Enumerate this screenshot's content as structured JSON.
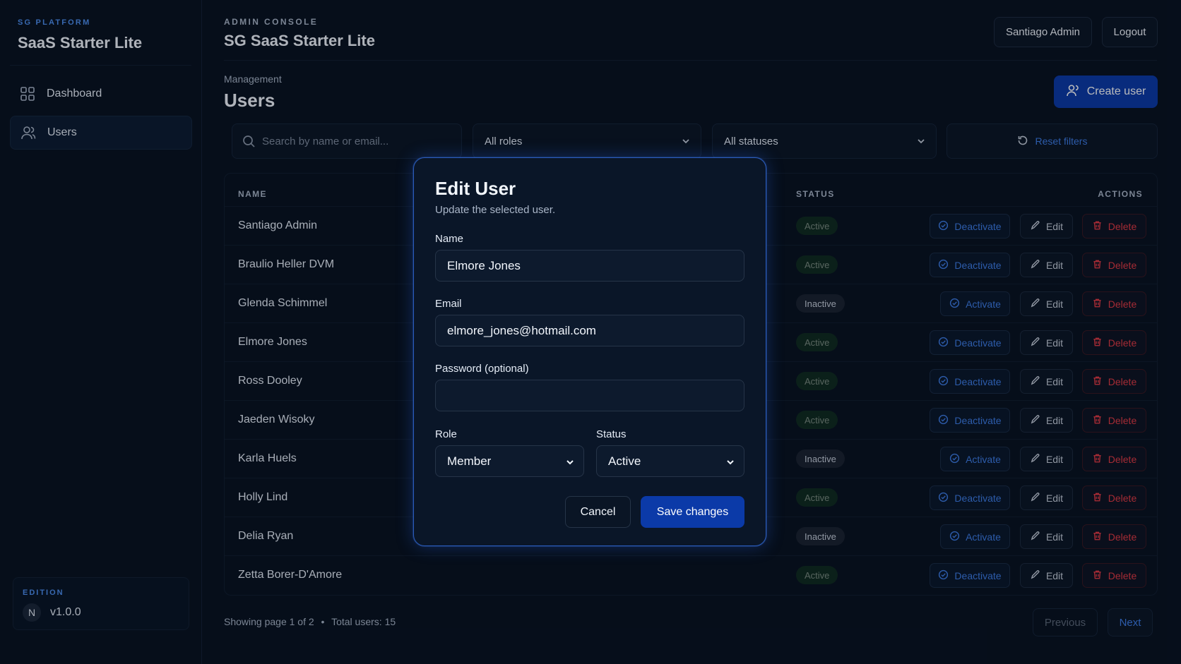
{
  "sidebar": {
    "eyebrow": "SG PLATFORM",
    "title": "SaaS Starter Lite",
    "items": [
      {
        "label": "Dashboard",
        "icon": "grid-icon",
        "active": false
      },
      {
        "label": "Users",
        "icon": "users-icon",
        "active": true
      }
    ],
    "edition": {
      "label": "EDITION",
      "badge": "N",
      "version": "v1.0.0"
    }
  },
  "header": {
    "eyebrow": "ADMIN CONSOLE",
    "title": "SG SaaS Starter Lite",
    "user_button": "Santiago Admin",
    "logout_button": "Logout"
  },
  "page": {
    "breadcrumb": "Management",
    "title": "Users",
    "create_button": "Create user"
  },
  "filters": {
    "search_placeholder": "Search by name or email...",
    "role": "All roles",
    "status": "All statuses",
    "reset": "Reset filters"
  },
  "table": {
    "headers": {
      "name": "NAME",
      "status": "STATUS",
      "actions": "ACTIONS"
    },
    "edit_label": "Edit",
    "delete_label": "Delete",
    "rows": [
      {
        "name": "Santiago Admin",
        "status": "Active",
        "action": "Deactivate"
      },
      {
        "name": "Braulio Heller DVM",
        "status": "Active",
        "action": "Deactivate"
      },
      {
        "name": "Glenda Schimmel",
        "status": "Inactive",
        "action": "Activate"
      },
      {
        "name": "Elmore Jones",
        "status": "Active",
        "action": "Deactivate"
      },
      {
        "name": "Ross Dooley",
        "status": "Active",
        "action": "Deactivate"
      },
      {
        "name": "Jaeden Wisoky",
        "status": "Active",
        "action": "Deactivate"
      },
      {
        "name": "Karla Huels",
        "status": "Inactive",
        "action": "Activate"
      },
      {
        "name": "Holly Lind",
        "status": "Active",
        "action": "Deactivate"
      },
      {
        "name": "Delia Ryan",
        "status": "Inactive",
        "action": "Activate"
      },
      {
        "name": "Zetta Borer-D'Amore",
        "status": "Active",
        "action": "Deactivate"
      }
    ]
  },
  "pagination": {
    "info": "Showing page 1 of 2",
    "separator": "•",
    "total": "Total users: 15",
    "previous": "Previous",
    "next": "Next"
  },
  "modal": {
    "title": "Edit User",
    "subtitle": "Update the selected user.",
    "name_label": "Name",
    "name_value": "Elmore Jones",
    "email_label": "Email",
    "email_value": "elmore_jones@hotmail.com",
    "password_label": "Password (optional)",
    "password_value": "",
    "role_label": "Role",
    "role_value": "Member",
    "status_label": "Status",
    "status_value": "Active",
    "cancel": "Cancel",
    "save": "Save changes"
  },
  "colors": {
    "background": "#07111f",
    "accent": "#0b3aa8",
    "link": "#3d7de8",
    "danger": "#e43a44",
    "modal_border": "#2a5ab8"
  }
}
